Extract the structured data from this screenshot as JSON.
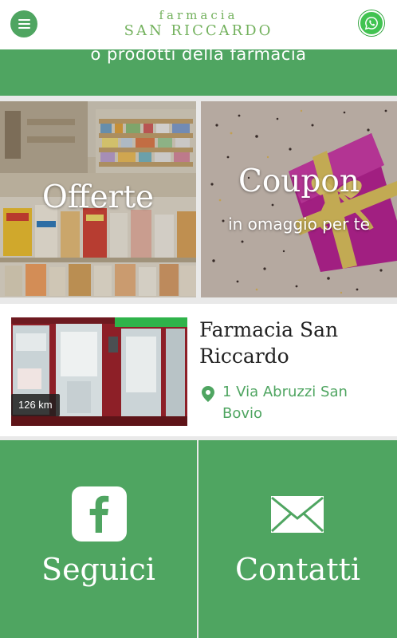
{
  "header": {
    "logo_top": "farmacia",
    "logo_bottom": "SAN RICCARDO",
    "menu_icon": "hamburger-menu-icon",
    "whatsapp_icon": "whatsapp-icon"
  },
  "banner": {
    "text": "o prodotti della farmacia"
  },
  "tiles": {
    "offerte": {
      "title": "Offerte"
    },
    "coupon": {
      "title": "Coupon",
      "subtitle": "in omaggio per te"
    }
  },
  "store": {
    "distance": "126 km",
    "name": "Farmacia San Riccardo",
    "address": "1 Via Abruzzi San Bovio"
  },
  "bottom": {
    "social_label": "Seguici",
    "contact_label": "Contatti"
  },
  "colors": {
    "brand_green": "#4fa561",
    "logo_green": "#73b15d",
    "whatsapp_green": "#41c351"
  }
}
